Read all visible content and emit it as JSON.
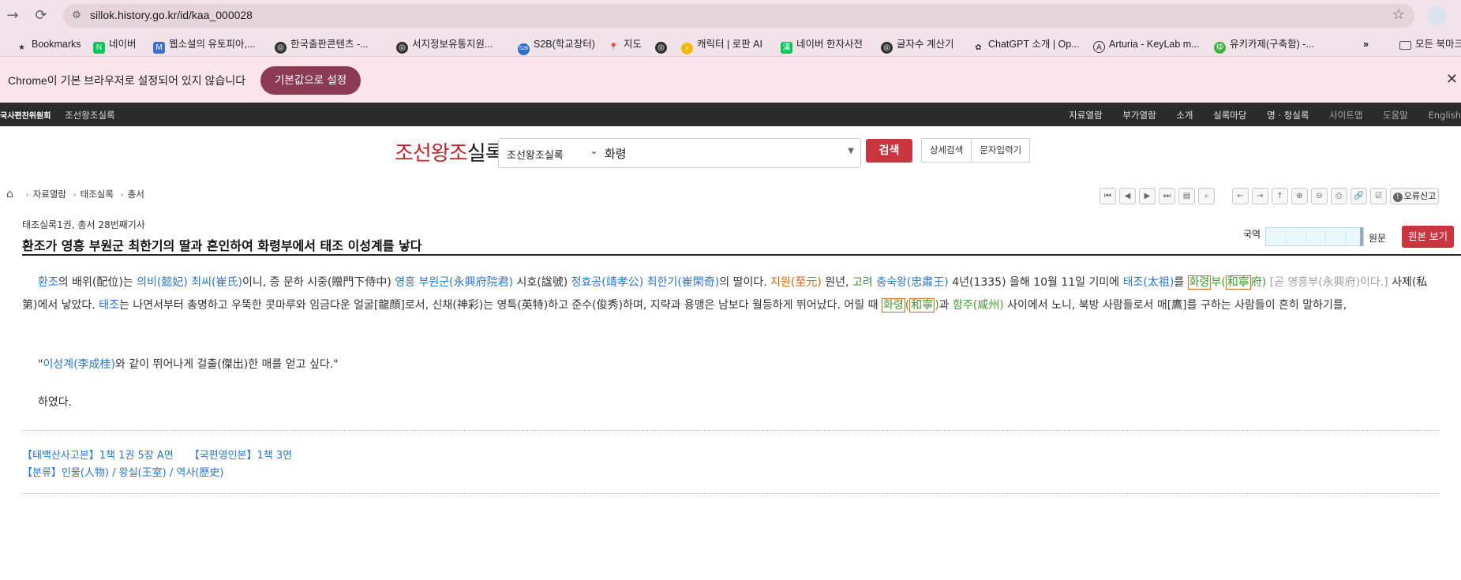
{
  "browser": {
    "url": "sillok.history.go.kr/id/kaa_000028",
    "bookmarks": [
      "Bookmarks",
      "네이버",
      "웹소설의 유토피아,...",
      "한국출판콘텐츠 -...",
      "서지정보유통지원...",
      "S2B(학교장터)",
      "지도",
      "",
      "캐릭터 | 로판 AI",
      "네이버 한자사전",
      "글자수 계산기",
      "ChatGPT 소개 | Op...",
      "Arturia - KeyLab m...",
      "유키카제(구축함) -..."
    ],
    "more_label": "»",
    "all_bookmarks": "모든 북마크"
  },
  "infobar": {
    "message": "Chrome이 기본 브라우저로 설정되어 있지 않습니다",
    "button": "기본값으로 설정"
  },
  "sitebar": {
    "org": "국사편찬위원회",
    "site": "조선왕조실록",
    "menu": [
      "자료열람",
      "부가열람",
      "소개",
      "실록마당",
      "명 · 청실록"
    ],
    "util": [
      "사이트맵",
      "도움말",
      "English"
    ]
  },
  "header": {
    "logo_red": "조선왕조",
    "logo_black": "실록",
    "search_scope": "조선왕조실록",
    "search_query": "화령",
    "search_button": "검색",
    "advanced": "상세검색",
    "char_input": "문자입력기"
  },
  "breadcrumb": [
    "자료열람",
    "태조실록",
    "총서"
  ],
  "toolbar": {
    "report": "오류신고"
  },
  "article": {
    "meta": "태조실록1권, 총서 28번째기사",
    "title": "환조가 영흥 부원군 최한기의 딸과 혼인하여 화령부에서 태조 이성계를 낳다",
    "lang_left": "국역",
    "lang_right": "원문",
    "original_button": "원본 보기",
    "p1": {
      "t1": "환조",
      "t2": "의 배위(配位)는 ",
      "t3": "의비(懿妃)",
      "t4": " ",
      "t5": "최씨(崔氏)",
      "t6": "이니, 증 문하 시중(贈門下侍中) ",
      "t7": "영흥 부원군(永興府院君)",
      "t8": " 시호(諡號) ",
      "t9": "정효공(靖孝公)",
      "t10": " ",
      "t11": "최한기(崔閑奇)",
      "t12": "의 딸이다. ",
      "t13": "지원(至元)",
      "t14": " 원년, ",
      "t15": "고려",
      "t16": " ",
      "t17": "충숙왕(忠肅王)",
      "t18": " 4년(1335) 을해 10월 11일 기미에 ",
      "t19": "태조(太祖)",
      "t20": "를 ",
      "t21": "화령",
      "t22": "부(",
      "t23": "和寧",
      "t24": "府)",
      "t25": " [곧 영흥부(永興府)이다.]",
      "t26": " 사제(私第)에서 낳았다. ",
      "t27": "태조",
      "t28": "는 나면서부터 총명하고 우뚝한 콧마루와 임금다운 얼굴[龍顔]로서, 신채(神彩)는 영특(英特)하고 준수(俊秀)하며, 지략과 용맹은 남보다 월등하게 뛰어났다. 어릴 때 ",
      "t29": "화령",
      "t30": "(",
      "t31": "和寧",
      "t32": ")",
      "t33": "과 ",
      "t34": "함주(咸州)",
      "t35": " 사이에서 노니, 북방 사람들로서 매[鷹]를 구하는 사람들이 흔히 말하기를,"
    },
    "p2": {
      "q1": "\"",
      "q2": "이성계(李成桂)",
      "q3": "와 같이 뛰어나게 걸출(傑出)한 매를 얻고 싶다.\""
    },
    "p3": "하였다.",
    "source1": "【태백산사고본】1책 1권 5장 A면",
    "source2": "【국편영인본】1책 3면",
    "category": "【분류】인물(人物) / 왕실(王室) / 역사(歷史)"
  }
}
